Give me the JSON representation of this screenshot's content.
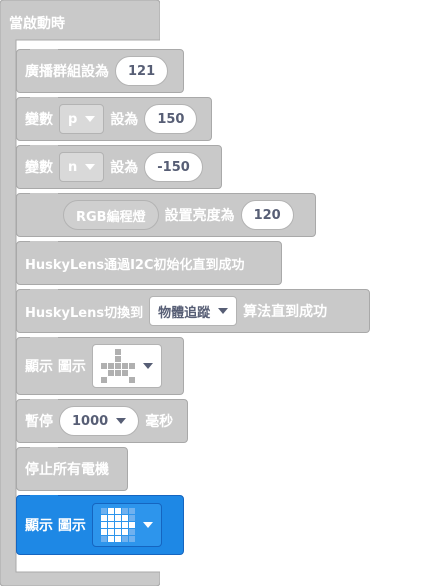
{
  "hat": {
    "label": "當啟動時",
    "color": "#c9c9c9"
  },
  "blocks": [
    {
      "id": "broadcast",
      "label": "廣播群組設為",
      "value": "121"
    },
    {
      "id": "var_p",
      "label": "變數",
      "dropdown": "p",
      "mid": "設為",
      "value": "150"
    },
    {
      "id": "var_n",
      "label": "變數",
      "dropdown": "n",
      "mid": "設為",
      "value": "-150"
    },
    {
      "id": "rgb",
      "label": "RGB編程燈",
      "mid": "設置亮度為",
      "value": "120"
    },
    {
      "id": "husky_init",
      "label": "HuskyLens通過I2C初始化直到成功"
    },
    {
      "id": "husky_switch",
      "label": "HuskyLens切換到",
      "dropdown": "物體追蹤",
      "suffix": "算法直到成功"
    },
    {
      "id": "show_icon_1",
      "label": "顯示 圖示"
    },
    {
      "id": "pause",
      "label": "暫停",
      "value": "1000",
      "suffix": "毫秒"
    },
    {
      "id": "stop_motors",
      "label": "停止所有電機"
    },
    {
      "id": "show_icon_2",
      "label": "顯示 圖示",
      "color": "#1e88e5"
    }
  ]
}
